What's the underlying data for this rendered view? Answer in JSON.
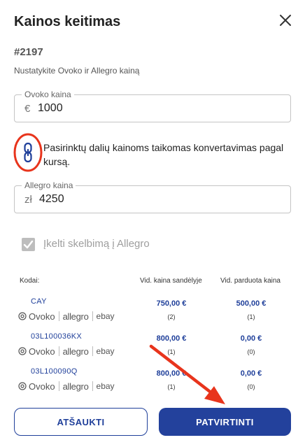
{
  "dialog": {
    "title": "Kainos keitimas",
    "order_id": "#2197",
    "subtitle": "Nustatykite Ovoko ir Allegro kainą"
  },
  "ovoko_field": {
    "label": "Ovoko kaina",
    "currency": "€",
    "value": "1000"
  },
  "link_note": "Pasirinktų dalių kainoms taikomas konvertavimas pagal kursą.",
  "allegro_field": {
    "label": "Allegro kaina",
    "currency": "zł",
    "value": "4250"
  },
  "checkbox": {
    "label": "Įkelti skelbimą į Allegro",
    "checked": true,
    "disabled": true
  },
  "table": {
    "headers": {
      "code": "Kodai:",
      "avg_stock": "Vid. kaina sandėlyje",
      "avg_sold": "Vid. parduota kaina"
    },
    "platforms": {
      "ovoko": "Ovoko",
      "allegro": "allegro",
      "ebay": "ebay"
    },
    "rows": [
      {
        "code": "CAY",
        "avg_stock": "750,00 €",
        "stock_count": "(2)",
        "avg_sold": "500,00 €",
        "sold_count": "(1)"
      },
      {
        "code": "03L100036KX",
        "avg_stock": "800,00 €",
        "stock_count": "(1)",
        "avg_sold": "0,00 €",
        "sold_count": "(0)"
      },
      {
        "code": "03L100090Q",
        "avg_stock": "800,00 €",
        "stock_count": "(1)",
        "avg_sold": "0,00 €",
        "sold_count": "(0)"
      }
    ]
  },
  "buttons": {
    "cancel": "ATŠAUKTI",
    "confirm": "PATVIRTINTI"
  },
  "colors": {
    "primary": "#23419c",
    "annotation": "#e8341c"
  }
}
